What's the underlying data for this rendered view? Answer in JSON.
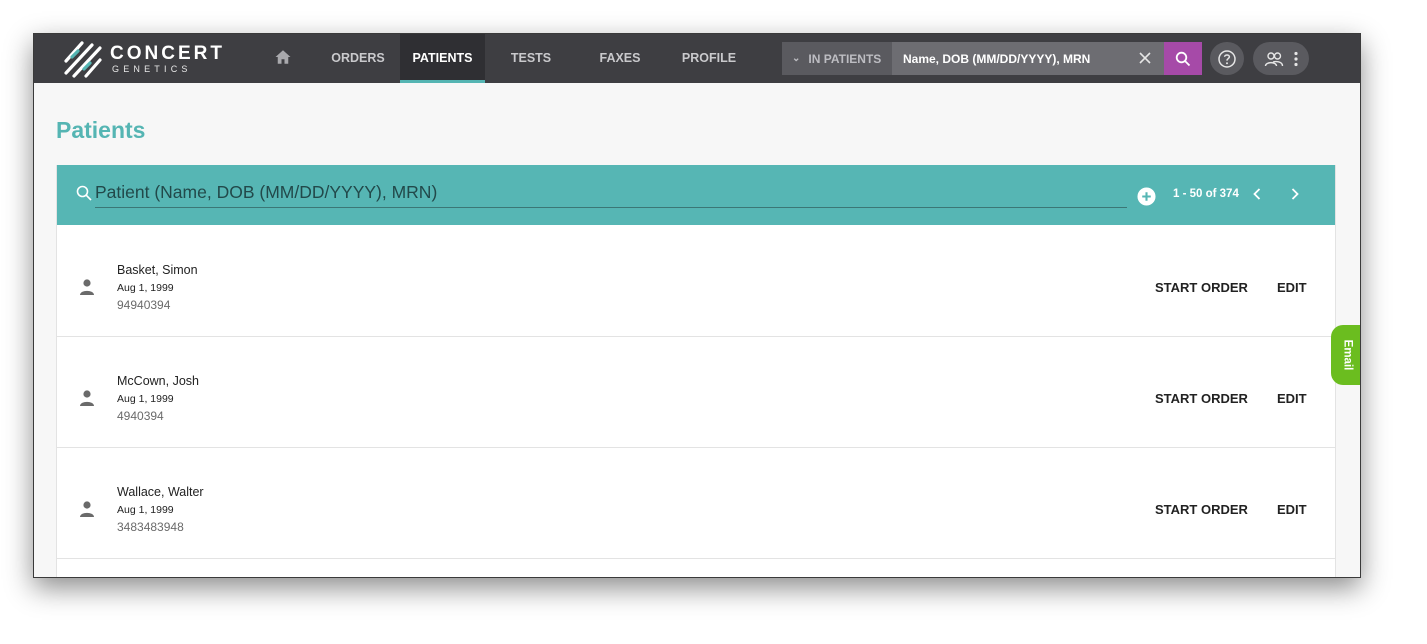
{
  "app": {
    "brand": "CONCERT",
    "brand_sub": "GENETICS"
  },
  "nav": {
    "items": [
      {
        "label": "ORDERS"
      },
      {
        "label": "PATIENTS"
      },
      {
        "label": "TESTS"
      },
      {
        "label": "FAXES"
      },
      {
        "label": "PROFILE"
      }
    ],
    "active": "PATIENTS"
  },
  "global_search": {
    "scope": "IN PATIENTS",
    "placeholder": "Name, DOB (MM/DD/YYYY), MRN"
  },
  "page": {
    "title": "Patients"
  },
  "list": {
    "search_placeholder": "Patient (Name, DOB (MM/DD/YYYY), MRN)",
    "pagination": "1 - 50 of 374",
    "start_order_label": "START ORDER",
    "edit_label": "EDIT",
    "patients": [
      {
        "name": "Basket, Simon",
        "dob": "Aug 1, 1999",
        "mrn": "94940394"
      },
      {
        "name": "McCown, Josh",
        "dob": "Aug 1, 1999",
        "mrn": "4940394"
      },
      {
        "name": "Wallace, Walter",
        "dob": "Aug 1, 1999",
        "mrn": "3483483948"
      }
    ]
  },
  "feedback": {
    "email_label": "Email"
  },
  "colors": {
    "accent": "#56b6b4",
    "search_button": "#a64aa8",
    "email_tab": "#6bbd1f",
    "topbar": "#3e3e42"
  }
}
